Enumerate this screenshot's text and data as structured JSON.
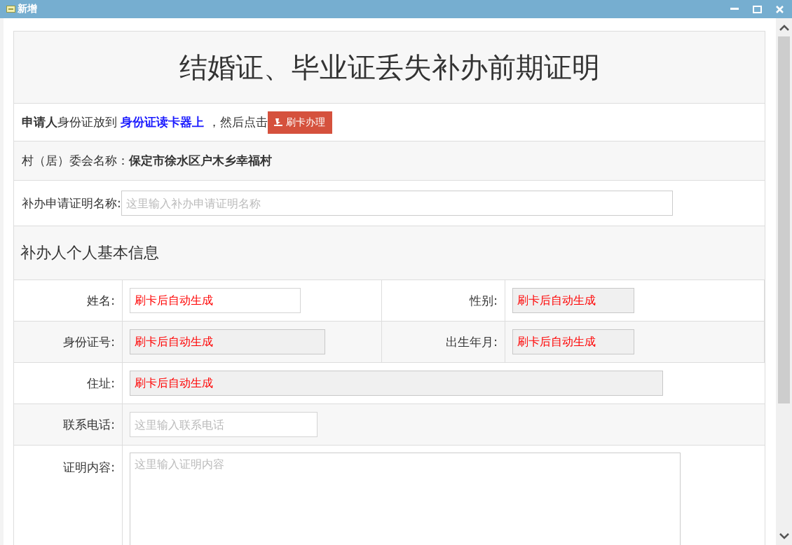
{
  "window": {
    "title": "新增"
  },
  "form": {
    "title": "结婚证、毕业证丢失补办前期证明",
    "instruction": {
      "parts": [
        {
          "kind": "bold",
          "text": "申请人"
        },
        {
          "kind": "plain",
          "text": "身份证放到 "
        },
        {
          "kind": "highlight",
          "text": "身份证读卡器上"
        },
        {
          "kind": "plain",
          "text": " ，然后点击"
        }
      ],
      "button": "刷卡办理"
    },
    "village": {
      "label": "村（居）委会名称：",
      "value": "保定市徐水区户木乡幸福村"
    },
    "certificate_name": {
      "label": "补办申请证明名称:",
      "placeholder": "这里输入补办申请证明名称"
    },
    "section_title": "补办人个人基本信息",
    "rows": [
      {
        "cells": [
          {
            "label": "姓名:",
            "value": "刷卡后自动生成",
            "readonly": false
          },
          {
            "label": "性别:",
            "value": "刷卡后自动生成",
            "readonly": true
          }
        ]
      },
      {
        "cells": [
          {
            "label": "身份证号:",
            "value": "刷卡后自动生成",
            "readonly": true
          },
          {
            "label": "出生年月:",
            "value": "刷卡后自动生成",
            "readonly": true
          }
        ]
      },
      {
        "cells": [
          {
            "label": "住址:",
            "value": "刷卡后自动生成",
            "readonly": true
          }
        ]
      },
      {
        "cells": [
          {
            "label": "联系电话:",
            "placeholder": "这里输入联系电话",
            "readonly": false
          }
        ]
      }
    ],
    "content": {
      "label": "证明内容:",
      "placeholder": "这里输入证明内容"
    }
  }
}
